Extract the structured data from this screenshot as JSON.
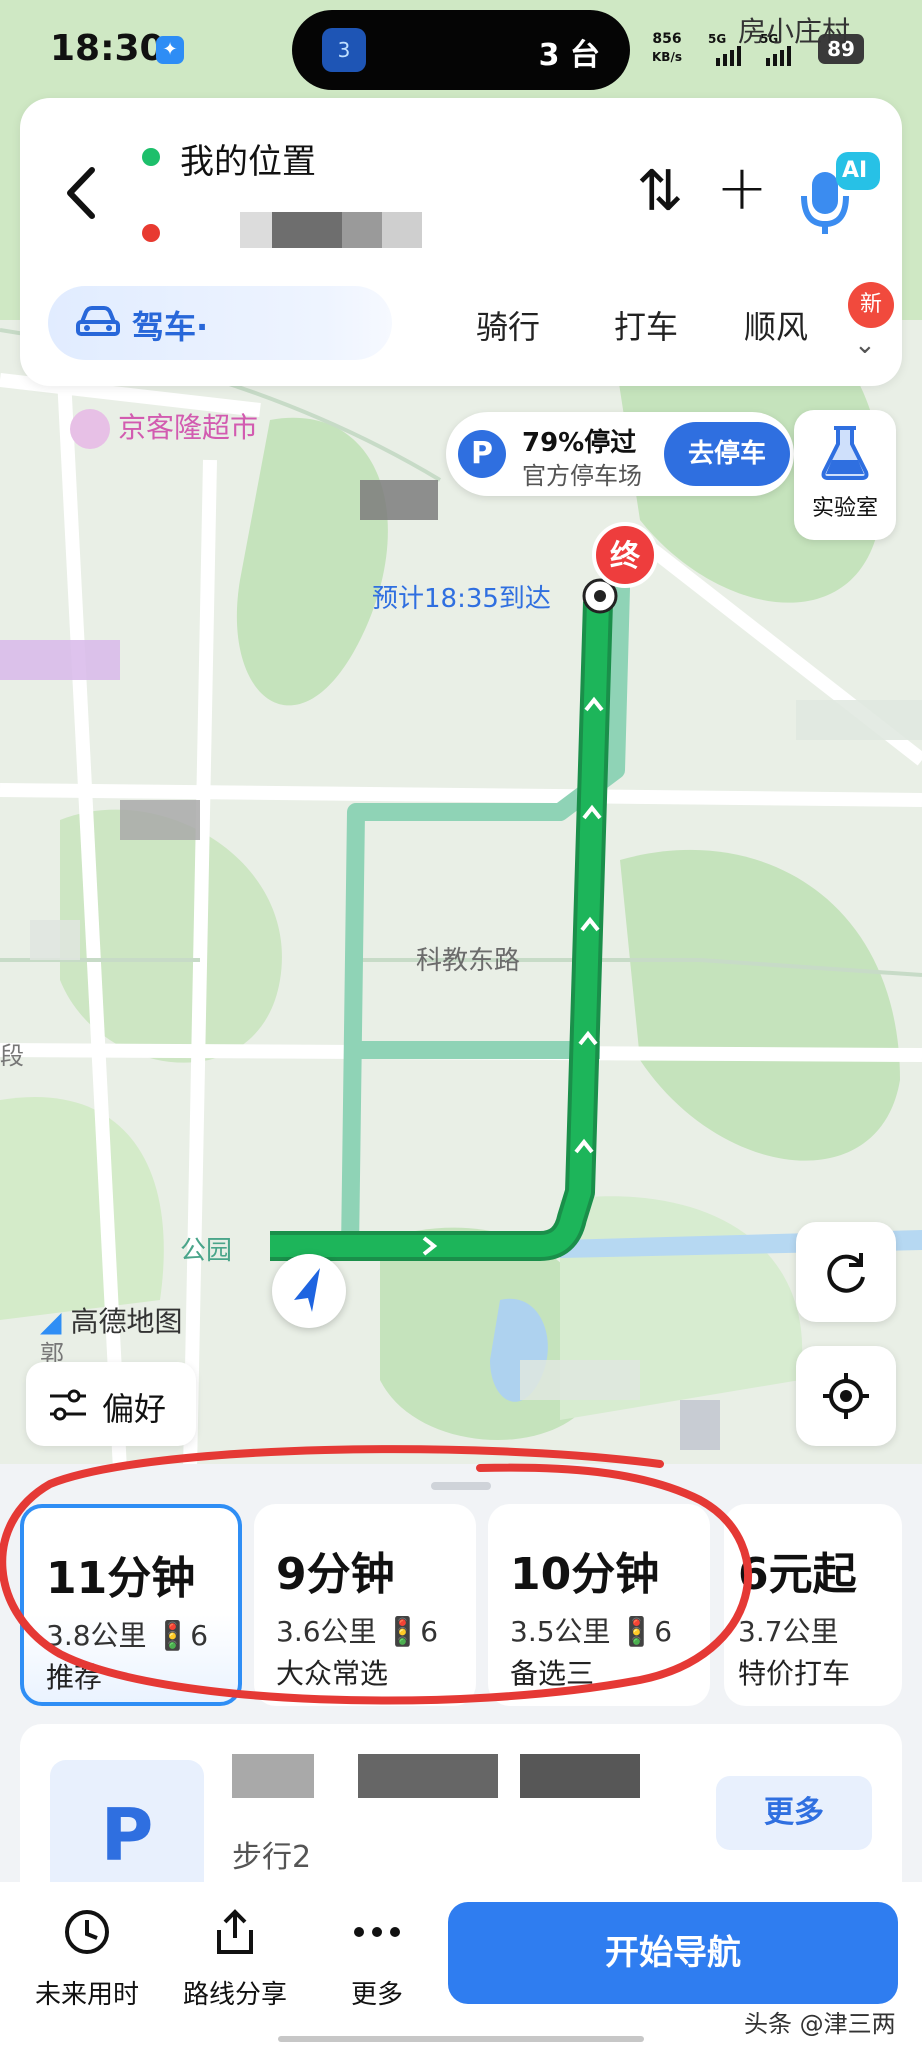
{
  "status_bar": {
    "time": "18:30",
    "island_text": "3 台",
    "island_icon": "3",
    "net_speed": "856",
    "net_unit": "KB/s",
    "sim1": "5G",
    "sim2": "5G",
    "battery": "89",
    "overlay_place": "房小庄村"
  },
  "route": {
    "origin": "我的位置",
    "mode_selected": "驾车·",
    "modes": [
      "骑行",
      "打车",
      "顺风"
    ],
    "new_badge": "新",
    "ai_label": "AI"
  },
  "map": {
    "poi_name": "京客隆超市",
    "parking_tip": {
      "icon": "P",
      "line1": "79%停过",
      "line2": "官方停车场",
      "button": "去停车"
    },
    "lab_label": "实验室",
    "end_marker": "终",
    "eta": "预计18:35到达",
    "road_name": "科教东路",
    "park_name": "公园",
    "left_label": "段",
    "logo_text": "高德地图",
    "logo_sub": "郭",
    "preference": "偏好"
  },
  "route_options": [
    {
      "time": "11分钟",
      "detail": "3.8公里  🚦6",
      "name": "推荐"
    },
    {
      "time": "9分钟",
      "detail": "3.6公里  🚦6",
      "name": "大众常选"
    },
    {
      "time": "10分钟",
      "detail": "3.5公里  🚦6",
      "name": "备选三"
    },
    {
      "time": "6元起",
      "detail": "3.7公里",
      "name": "特价打车"
    }
  ],
  "parking_card": {
    "icon": "P",
    "walk": "步行2",
    "more": "更多"
  },
  "bottom_bar": {
    "future_time": "未来用时",
    "share": "路线分享",
    "more": "更多",
    "start": "开始导航"
  },
  "watermark": "头条 @津三两",
  "colors": {
    "route_green": "#1db55a",
    "alt_route": "#8fd3b6",
    "accent_blue": "#2f7df0",
    "annotation_red": "#e53935"
  }
}
